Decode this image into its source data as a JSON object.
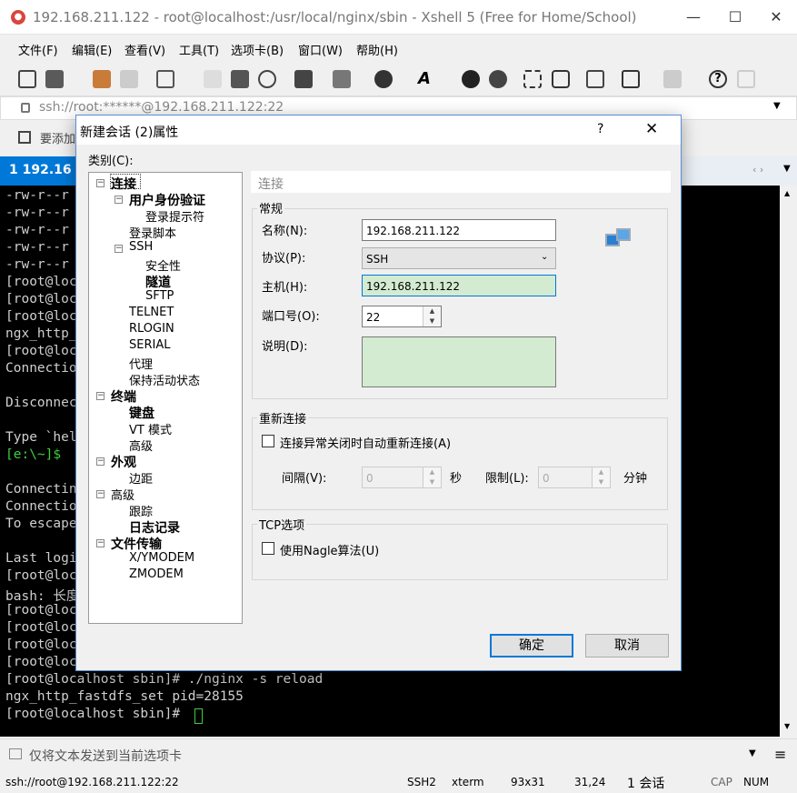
{
  "window": {
    "title": "192.168.211.122 - root@localhost:/usr/local/nginx/sbin - Xshell 5 (Free for Home/School)"
  },
  "menu": [
    "文件(F)",
    "编辑(E)",
    "查看(V)",
    "工具(T)",
    "选项卡(B)",
    "窗口(W)",
    "帮助(H)"
  ],
  "address": "ssh://root:******@192.168.211.122:22",
  "quickbar_label": "要添加",
  "tab": {
    "label": "1 192.16"
  },
  "terminal_lines": [
    "-rw-r--r",
    "-rw-r--r",
    "-rw-r--r",
    "-rw-r--r",
    "-rw-r--r",
    "[root@loc",
    "[root@loc",
    "[root@loc",
    "ngx_http_",
    "[root@loc",
    "Connectio",
    "",
    "Disconnec",
    "",
    "Type `hel",
    "[e:\\~]$",
    "",
    "Connectin",
    "Connectio",
    "To escape",
    "",
    "Last logi",
    "[root@loc",
    "bash: 长度",
    "[root@loc",
    "[root@loc",
    "[root@loc",
    "[root@loc",
    "[root@localhost sbin]# ./nginx -s reload",
    "ngx_http_fastdfs_set pid=28155",
    "[root@localhost sbin]# "
  ],
  "sendbar_text": "仅将文本发送到当前选项卡",
  "status": {
    "conn": "ssh://root@192.168.211.122:22",
    "proto": "SSH2",
    "term": "xterm",
    "size": "93x31",
    "pos": "31,24",
    "sessions": "1 会话",
    "cap": "CAP",
    "num": "NUM"
  },
  "dialog": {
    "title": "新建会话 (2)属性",
    "help": "?",
    "category_label": "类别(C):",
    "tree": [
      {
        "label": "连接",
        "level": 0,
        "bold": true,
        "expander": "−"
      },
      {
        "label": "用户身份验证",
        "level": 1,
        "bold": true,
        "expander": "−"
      },
      {
        "label": "登录提示符",
        "level": 2,
        "bold": false
      },
      {
        "label": "登录脚本",
        "level": 1,
        "bold": false
      },
      {
        "label": "SSH",
        "level": 1,
        "bold": false,
        "expander": "−"
      },
      {
        "label": "安全性",
        "level": 2,
        "bold": false
      },
      {
        "label": "隧道",
        "level": 2,
        "bold": true
      },
      {
        "label": "SFTP",
        "level": 2,
        "bold": false
      },
      {
        "label": "TELNET",
        "level": 1,
        "bold": false
      },
      {
        "label": "RLOGIN",
        "level": 1,
        "bold": false
      },
      {
        "label": "SERIAL",
        "level": 1,
        "bold": false
      },
      {
        "label": "代理",
        "level": 1,
        "bold": false
      },
      {
        "label": "保持活动状态",
        "level": 1,
        "bold": false
      },
      {
        "label": "终端",
        "level": 0,
        "bold": true,
        "expander": "−"
      },
      {
        "label": "键盘",
        "level": 1,
        "bold": true
      },
      {
        "label": "VT 模式",
        "level": 1,
        "bold": false
      },
      {
        "label": "高级",
        "level": 1,
        "bold": false
      },
      {
        "label": "外观",
        "level": 0,
        "bold": true,
        "expander": "−"
      },
      {
        "label": "边距",
        "level": 1,
        "bold": false
      },
      {
        "label": "高级",
        "level": 0,
        "bold": false,
        "expander": "−"
      },
      {
        "label": "跟踪",
        "level": 1,
        "bold": false
      },
      {
        "label": "日志记录",
        "level": 1,
        "bold": true
      },
      {
        "label": "文件传输",
        "level": 0,
        "bold": true,
        "expander": "−"
      },
      {
        "label": "X/YMODEM",
        "level": 1,
        "bold": false
      },
      {
        "label": "ZMODEM",
        "level": 1,
        "bold": false
      }
    ],
    "section_header": "连接",
    "general": {
      "legend": "常规",
      "name_label": "名称(N):",
      "name_value": "192.168.211.122",
      "protocol_label": "协议(P):",
      "protocol_value": "SSH",
      "host_label": "主机(H):",
      "host_value": "192.168.211.122",
      "port_label": "端口号(O):",
      "port_value": "22",
      "desc_label": "说明(D):"
    },
    "reconnect": {
      "legend": "重新连接",
      "checkbox_label": "连接异常关闭时自动重新连接(A)",
      "interval_label": "间隔(V):",
      "interval_value": "0",
      "interval_unit": "秒",
      "limit_label": "限制(L):",
      "limit_value": "0",
      "limit_unit": "分钟"
    },
    "tcp": {
      "legend": "TCP选项",
      "nagle_label": "使用Nagle算法(U)"
    },
    "ok": "确定",
    "cancel": "取消"
  }
}
